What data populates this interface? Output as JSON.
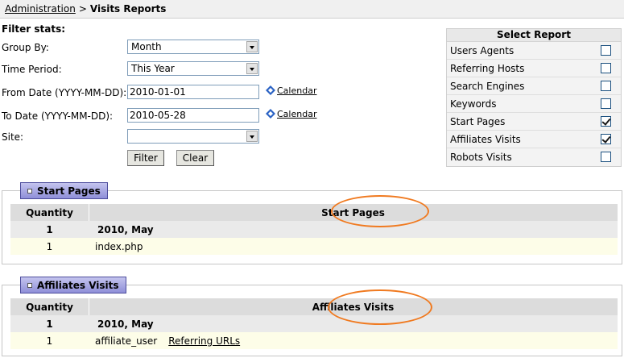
{
  "breadcrumb": {
    "root": "Administration",
    "separator": ">",
    "current": "Visits Reports"
  },
  "filter": {
    "title": "Filter stats:",
    "group_by": {
      "label": "Group By:",
      "value": "Month"
    },
    "time_period": {
      "label": "Time Period:",
      "value": "This Year"
    },
    "from_date": {
      "label": "From Date (YYYY-MM-DD):",
      "value": "2010-01-01",
      "calendar": "Calendar"
    },
    "to_date": {
      "label": "To Date (YYYY-MM-DD):",
      "value": "2010-05-28",
      "calendar": "Calendar"
    },
    "site": {
      "label": "Site:",
      "value": ""
    },
    "filter_button": "Filter",
    "clear_button": "Clear"
  },
  "report_select": {
    "title": "Select Report",
    "items": [
      {
        "label": "Users Agents",
        "checked": false
      },
      {
        "label": "Referring Hosts",
        "checked": false
      },
      {
        "label": "Search Engines",
        "checked": false
      },
      {
        "label": "Keywords",
        "checked": false
      },
      {
        "label": "Start Pages",
        "checked": true
      },
      {
        "label": "Affiliates Visits",
        "checked": true
      },
      {
        "label": "Robots Visits",
        "checked": false
      }
    ]
  },
  "start_pages": {
    "tab": "Start Pages",
    "col_quantity": "Quantity",
    "col_name": "Start Pages",
    "group": {
      "quantity": "1",
      "label": "2010, May"
    },
    "row": {
      "quantity": "1",
      "name": "index.php"
    }
  },
  "affiliates": {
    "tab": "Affiliates Visits",
    "col_quantity": "Quantity",
    "col_name": "Affiliates Visits",
    "group": {
      "quantity": "1",
      "label": "2010, May"
    },
    "row": {
      "quantity": "1",
      "name": "affiliate_user",
      "link": "Referring URLs"
    }
  },
  "colors": {
    "tab_gradient_top": "#c4c4ee",
    "tab_gradient_bottom": "#8f8fd8",
    "annotation_oval": "#f07a20",
    "data_row_bg": "#fdfde8"
  }
}
